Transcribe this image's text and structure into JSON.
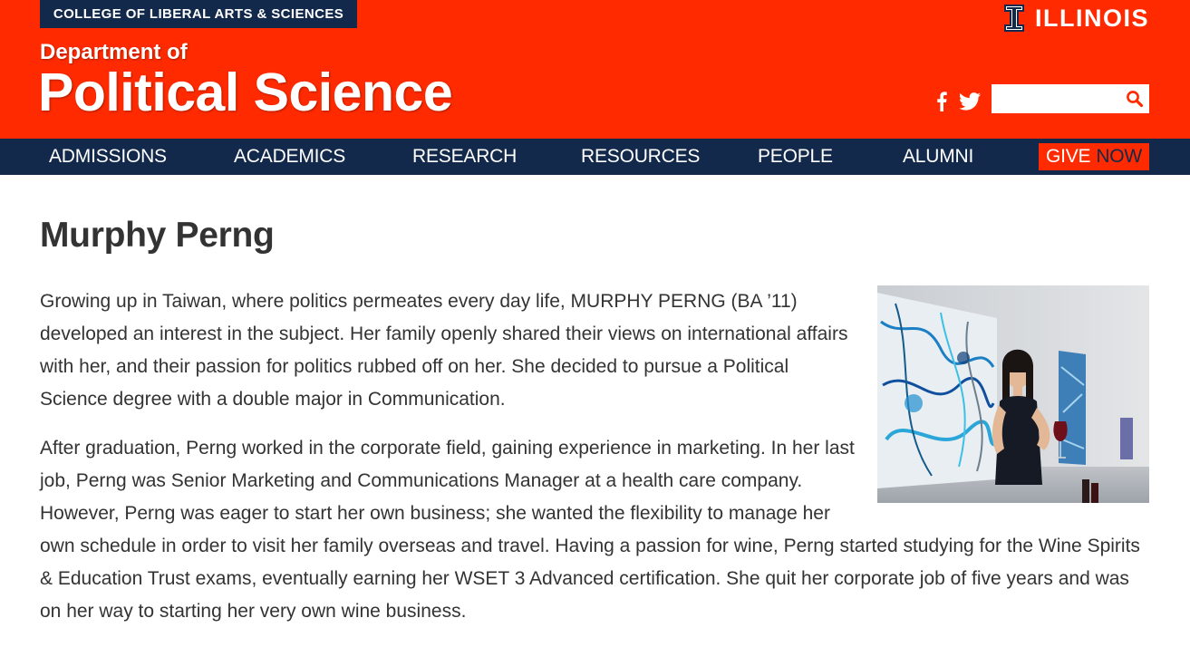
{
  "header": {
    "college": "COLLEGE OF LIBERAL ARTS & SCIENCES",
    "dept_small": "Department of",
    "dept_large": "Political Science",
    "university": "ILLINOIS",
    "search": {
      "placeholder": "",
      "value": ""
    }
  },
  "nav": {
    "items": [
      {
        "label": "ADMISSIONS"
      },
      {
        "label": "ACADEMICS"
      },
      {
        "label": "RESEARCH"
      },
      {
        "label": "RESOURCES"
      },
      {
        "label": "PEOPLE"
      },
      {
        "label": "ALUMNI"
      }
    ],
    "give": {
      "word1": "GIVE",
      "word2": "NOW"
    }
  },
  "article": {
    "title": "Murphy Perng",
    "paragraphs": [
      "Growing up in Taiwan, where politics permeates every day life, MURPHY PERNG (BA ’11) developed an interest in the subject. Her family openly shared their views on international affairs with her, and their passion for politics rubbed off on her. She decided to pursue a Political Science degree with a double major in Communication.",
      "After graduation, Perng worked in the corporate field, gaining experience in marketing. In her last job, Perng was Senior Marketing and Communications Manager at a health care company. However, Perng was eager to start her own business; she wanted the flexibility to manage her own schedule in order to visit her family overseas and travel. Having a passion for wine, Perng started studying for the Wine Spirits & Education Trust exams, eventually earning her WSET 3 Advanced certification. She quit her corporate job of five years and was on her way to starting her very own wine business."
    ]
  },
  "colors": {
    "orange": "#FF2A00",
    "navy": "#13294B",
    "text": "#333333"
  },
  "icons": {
    "university_logo": "block-i-icon",
    "facebook": "facebook-icon",
    "twitter": "twitter-icon",
    "search": "search-icon"
  }
}
